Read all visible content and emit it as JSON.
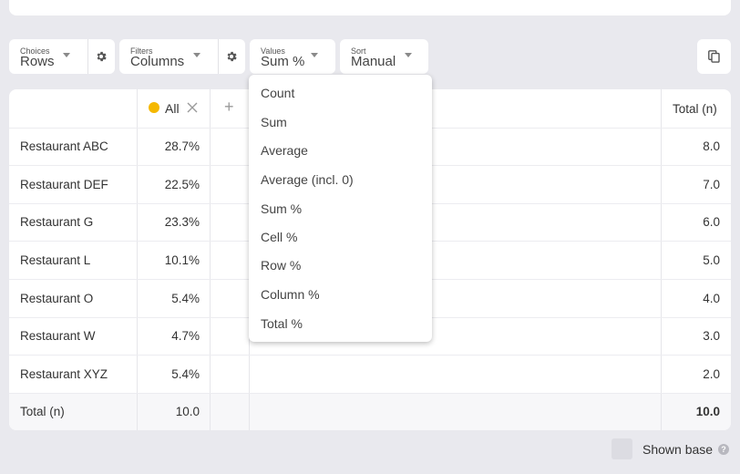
{
  "toolbar": {
    "choices": {
      "small": "Choices",
      "value": "Rows"
    },
    "filters": {
      "small": "Filters",
      "value": "Columns"
    },
    "values": {
      "small": "Values",
      "value": "Sum %"
    },
    "sort": {
      "small": "Sort",
      "value": "Manual"
    }
  },
  "table": {
    "header_all": "All",
    "header_total": "Total (n)",
    "all_dot_color": "#f5b800",
    "rows": [
      {
        "label": "Restaurant ABC",
        "all": "28.7%",
        "total": "8.0"
      },
      {
        "label": "Restaurant DEF",
        "all": "22.5%",
        "total": "7.0"
      },
      {
        "label": "Restaurant G",
        "all": "23.3%",
        "total": "6.0"
      },
      {
        "label": "Restaurant L",
        "all": "10.1%",
        "total": "5.0"
      },
      {
        "label": "Restaurant O",
        "all": "5.4%",
        "total": "4.0"
      },
      {
        "label": "Restaurant W",
        "all": "4.7%",
        "total": "3.0"
      },
      {
        "label": "Restaurant XYZ",
        "all": "5.4%",
        "total": "2.0"
      }
    ],
    "total_row": {
      "label": "Total (n)",
      "all": "10.0",
      "total": "10.0"
    }
  },
  "values_menu": {
    "options": [
      "Count",
      "Sum",
      "Average",
      "Average (incl. 0)",
      "Sum %",
      "Cell %",
      "Row %",
      "Column %",
      "Total %"
    ]
  },
  "footer": {
    "shown_base_label": "Shown base",
    "help_glyph": "?"
  }
}
